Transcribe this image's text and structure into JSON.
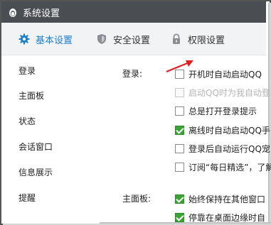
{
  "window": {
    "title": "系统设置"
  },
  "tabs": [
    {
      "label": "基本设置",
      "icon": "gear-icon",
      "active": true
    },
    {
      "label": "安全设置",
      "icon": "shield-icon",
      "active": false
    },
    {
      "label": "权限设置",
      "icon": "lock-icon",
      "active": false
    }
  ],
  "sidebar": {
    "items": [
      {
        "label": "登录"
      },
      {
        "label": "主面板"
      },
      {
        "label": "状态"
      },
      {
        "label": "会话窗口"
      },
      {
        "label": "信息展示"
      },
      {
        "label": "提醒"
      }
    ]
  },
  "login_section": {
    "label": "登录:",
    "options": [
      {
        "label": "开机时自动启动QQ",
        "checked": false,
        "disabled": false
      },
      {
        "label": "启动QQ时为我自动登",
        "checked": false,
        "disabled": true
      },
      {
        "label": "总是打开登录提示",
        "checked": false,
        "disabled": false
      },
      {
        "label": "离线时自动启动QQ手",
        "checked": true,
        "disabled": false
      },
      {
        "label": "登录后自动运行QQ宠",
        "checked": false,
        "disabled": false
      },
      {
        "label": "订阅“每日精选”，了解",
        "checked": false,
        "disabled": false
      }
    ]
  },
  "panel_section": {
    "label": "主面板:",
    "options": [
      {
        "label": "始终保持在其他窗口",
        "checked": true,
        "disabled": false
      },
      {
        "label": "停靠在桌面边缘时自",
        "checked": true,
        "disabled": false
      }
    ]
  },
  "colors": {
    "accent": "#1a7fd1",
    "titlebar": "#4a4d52",
    "check": "#3aa335",
    "arrow": "#e02020"
  }
}
